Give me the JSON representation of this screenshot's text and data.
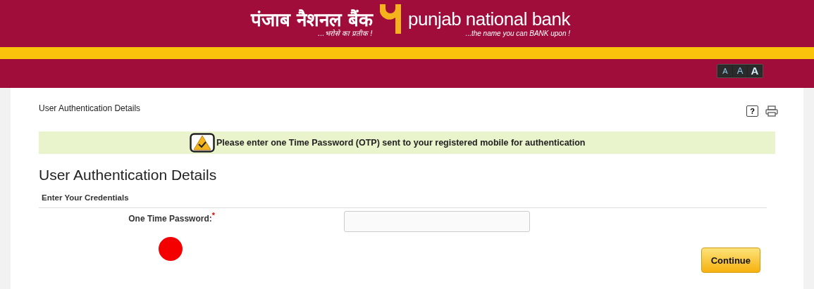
{
  "header": {
    "hindi_name": "पंजाब नैशनल बैंक",
    "hindi_tagline": "...भरोसे का प्रतीक !",
    "english_name": "punjab national bank",
    "english_tagline": "...the name you can BANK upon !"
  },
  "font_sizes": [
    {
      "label": "A",
      "selected": false
    },
    {
      "label": "A",
      "selected": false
    },
    {
      "label": "A",
      "selected": true
    }
  ],
  "page": {
    "breadcrumb": "User Authentication Details",
    "help": "?"
  },
  "notice": "Please enter one Time Password (OTP) sent to your registered mobile for authentication",
  "form": {
    "title": "User Authentication Details",
    "section": "Enter Your Credentials",
    "fields": [
      {
        "label": "One Time Password:",
        "required_mark": "*"
      }
    ]
  },
  "buttons": [
    "Continue"
  ]
}
